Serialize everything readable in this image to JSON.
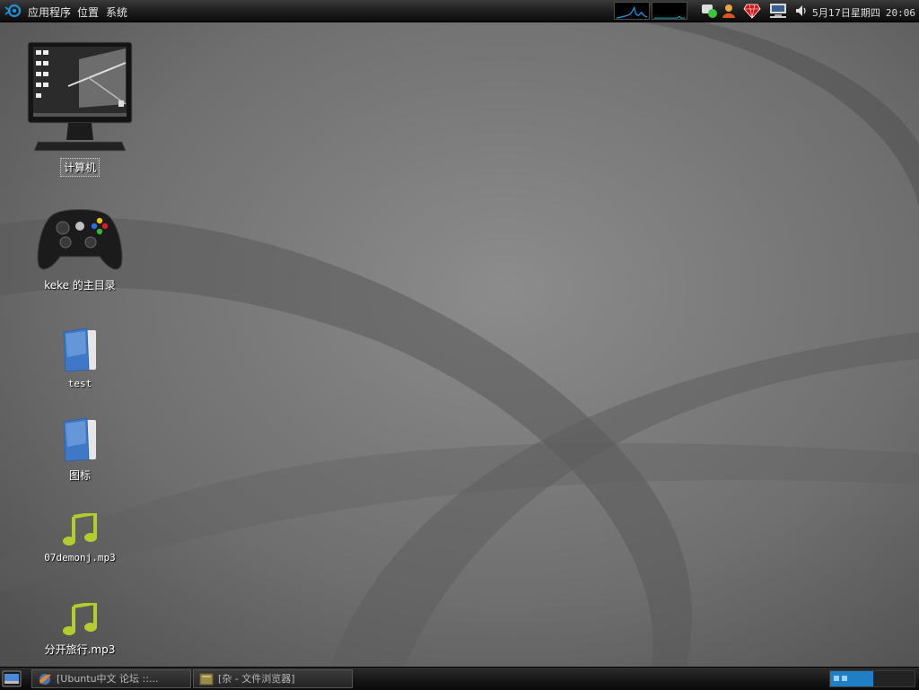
{
  "top_panel": {
    "menus": [
      "应用程序",
      "位置",
      "系统"
    ],
    "tray_icons": [
      "system-monitor-cpu",
      "system-monitor-net",
      "chat-status-icon",
      "user-icon",
      "ruby-icon",
      "network-icon",
      "volume-icon"
    ],
    "date": "5月17日星期四",
    "time": "20:06"
  },
  "desktop": {
    "icons": [
      {
        "name": "computer",
        "label": "计算机",
        "selected": true
      },
      {
        "name": "home-folder",
        "label": "keke 的主目录"
      },
      {
        "name": "folder-test",
        "label": "test"
      },
      {
        "name": "folder-icons",
        "label": "图标"
      },
      {
        "name": "audio-file-1",
        "label": "07demonj.mp3"
      },
      {
        "name": "audio-file-2",
        "label": "分开旅行.mp3"
      }
    ]
  },
  "taskbar": {
    "tasks": [
      {
        "label": "[Ubuntu中文 论坛 ::..."
      },
      {
        "label": "[杂 - 文件浏览器]"
      }
    ]
  },
  "colors": {
    "panel": "#1c1c1c",
    "wallpaper": "#6e6e6e",
    "accent_blue": "#1e90d8",
    "music_green": "#b5cc2e"
  }
}
